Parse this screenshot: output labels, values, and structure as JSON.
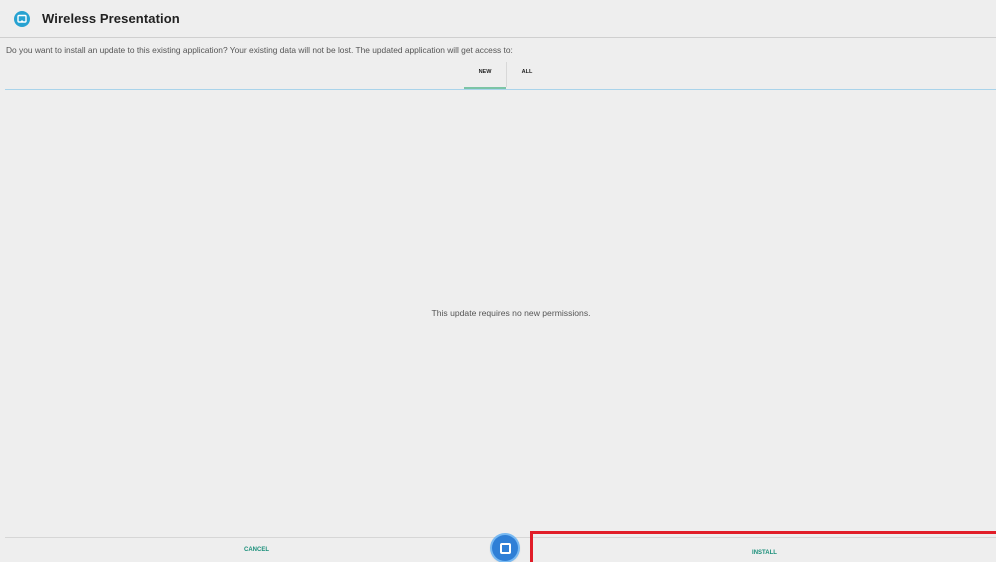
{
  "app": {
    "title": "Wireless Presentation",
    "icon": "wireless-presentation-app-icon",
    "accent_color": "#27a2d1"
  },
  "message": "Do you want to install an update to this existing application? Your existing data will not be lost. The updated application will get access to:",
  "tabs": [
    {
      "label": "NEW",
      "selected": true
    },
    {
      "label": "ALL",
      "selected": false
    }
  ],
  "content": {
    "empty_text": "This update requires no new permissions."
  },
  "footer": {
    "cancel_label": "CANCEL",
    "install_label": "INSTALL",
    "button_color": "#1a8f7a",
    "highlight_color": "#e11d28"
  },
  "overlay": {
    "icon": "square-nav-icon"
  }
}
